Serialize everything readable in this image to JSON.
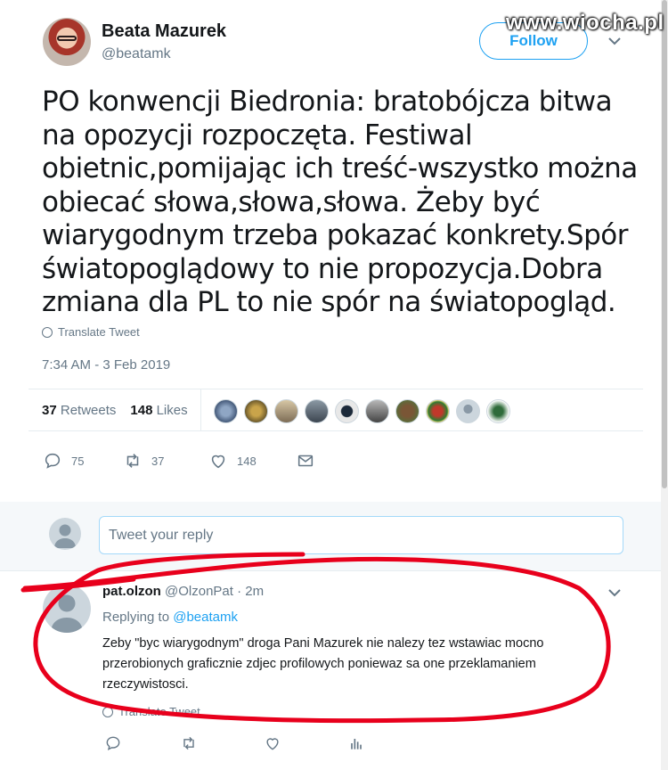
{
  "watermark": "www.wiocha.pl",
  "tweet": {
    "author_name": "Beata Mazurek",
    "author_handle": "@beatamk",
    "follow_label": "Follow",
    "text": "PO konwencji Biedronia: bratobójcza bitwa na opozycji rozpoczęta. Festiwal obietnic,pomijając ich treść-wszystko można obiecać słowa,słowa,słowa. Żeby być wiarygodnym trzeba pokazać konkrety.Spór światopoglądowy to nie propozycja.Dobra zmiana dla PL to nie spór na światopogląd.",
    "translate_label": "Translate Tweet",
    "timestamp": "7:34 AM - 3 Feb 2019",
    "retweets_count": "37",
    "retweets_label": "Retweets",
    "likes_count": "148",
    "likes_label": "Likes",
    "reply_count": "75",
    "retweet_action_count": "37",
    "like_action_count": "148"
  },
  "reply_box": {
    "placeholder": "Tweet your reply"
  },
  "reply": {
    "name": "pat.olzon",
    "handle": "@OlzonPat",
    "time": "· 2m",
    "replying_prefix": "Replying to",
    "replying_handle": "@beatamk",
    "text": "Zeby \"byc wiarygodnym\" droga Pani Mazurek nie nalezy tez wstawiac mocno przerobionych graficznie zdjec profilowych poniewaz sa one przeklamaniem rzeczywistosci.",
    "translate_label": "Translate Tweet"
  },
  "colors": {
    "accent": "#1da1f2",
    "muted": "#657786",
    "annotation": "#e8001c"
  }
}
